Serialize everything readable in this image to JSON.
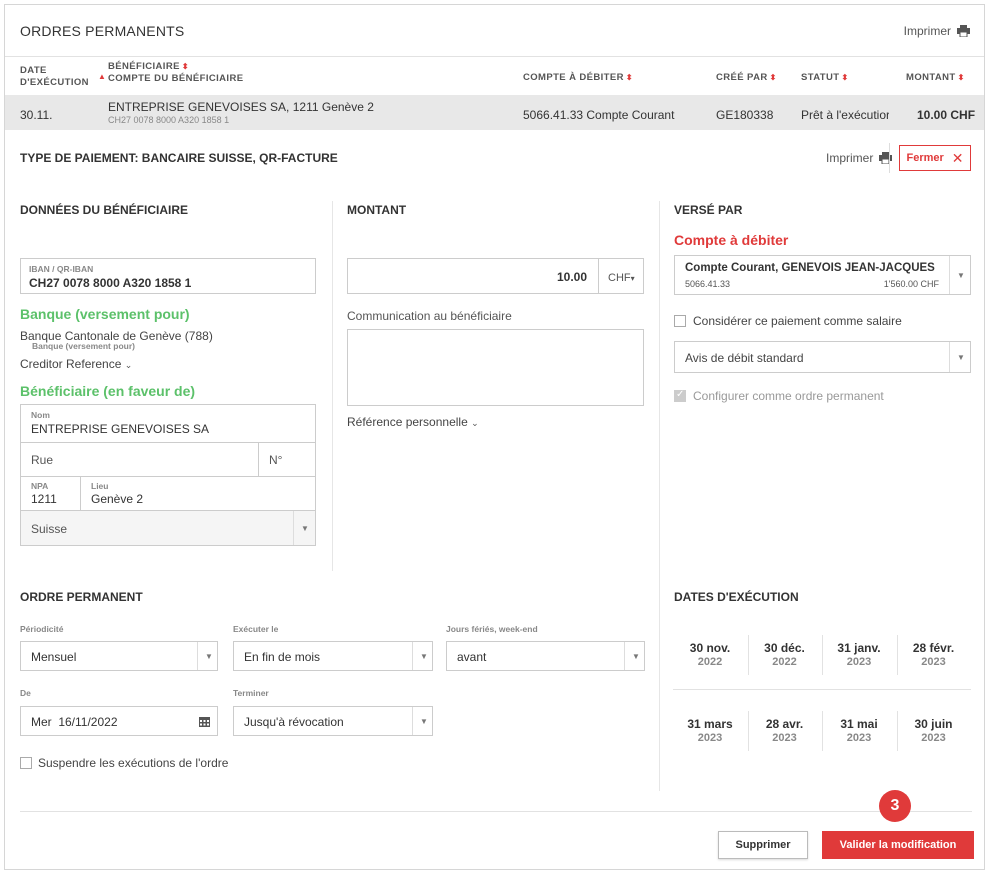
{
  "header": {
    "title": "ORDRES PERMANENTS",
    "print_label": "Imprimer"
  },
  "table": {
    "columns": {
      "date_line1": "DATE",
      "date_line2": "D'EXÉCUTION",
      "beneficiary_line1": "BÉNÉFICIAIRE",
      "beneficiary_line2": "COMPTE DU BÉNÉFICIAIRE",
      "debit_account": "COMPTE À DÉBITER",
      "created_by": "CRÉÉ PAR",
      "status": "STATUT",
      "amount": "MONTANT"
    },
    "row": {
      "date": "30.11.",
      "beneficiary": "ENTREPRISE GENEVOISES SA, 1211 Genève 2",
      "beneficiary_account": "CH27 0078 8000 A320 1858 1",
      "debit_account": "5066.41.33 Compte Courant",
      "created_by": "GE180338",
      "status": "Prêt à l'exécutior",
      "amount": "10.00 CHF"
    }
  },
  "detail": {
    "title": "TYPE DE PAIEMENT: BANCAIRE SUISSE, QR-FACTURE",
    "print_label": "Imprimer",
    "close_label": "Fermer"
  },
  "beneficiary": {
    "heading": "DONNÉES DU BÉNÉFICIAIRE",
    "iban_label": "IBAN / QR-IBAN",
    "iban_value": "CH27 0078 8000 A320 1858 1",
    "bank_heading": "Banque (versement pour)",
    "bank_name": "Banque Cantonale de Genève (788)",
    "bank_sub": "Banque (versement pour)",
    "creditor_ref": "Creditor Reference",
    "benef_heading": "Bénéficiaire (en faveur de)",
    "name_label": "Nom",
    "name_value": "ENTREPRISE GENEVOISES SA",
    "street_placeholder": "Rue",
    "number_placeholder": "N°",
    "npa_label": "NPA",
    "npa_value": "1211",
    "city_label": "Lieu",
    "city_value": "Genève 2",
    "country": "Suisse"
  },
  "amount": {
    "heading": "MONTANT",
    "value": "10.00",
    "currency": "CHF",
    "comm_label": "Communication au bénéficiaire",
    "personal_ref": "Référence personnelle"
  },
  "paid_by": {
    "heading": "VERSÉ PAR",
    "debit_heading": "Compte à débiter",
    "account_name": "Compte Courant, GENEVOIS JEAN-JACQUES",
    "account_number": "5066.41.33",
    "account_balance": "1'560.00 CHF",
    "salary_label": "Considérer ce paiement comme salaire",
    "debit_notice": "Avis de débit standard",
    "standing_order_label": "Configurer comme ordre permanent"
  },
  "standing_order": {
    "heading": "ORDRE PERMANENT",
    "periodicity_label": "Périodicité",
    "periodicity_value": "Mensuel",
    "execute_label": "Exécuter le",
    "execute_value": "En fin de mois",
    "holidays_label": "Jours fériés, week-end",
    "holidays_value": "avant",
    "from_label": "De",
    "from_value": "Mer  16/11/2022",
    "end_label": "Terminer",
    "end_value": "Jusqu'à révocation",
    "suspend_label": "Suspendre les exécutions de l'ordre"
  },
  "execution_dates": {
    "heading": "DATES D'EXÉCUTION",
    "dates": [
      {
        "day": "30 nov.",
        "year": "2022"
      },
      {
        "day": "30 déc.",
        "year": "2022"
      },
      {
        "day": "31 janv.",
        "year": "2023"
      },
      {
        "day": "28 févr.",
        "year": "2023"
      },
      {
        "day": "31 mars",
        "year": "2023"
      },
      {
        "day": "28 avr.",
        "year": "2023"
      },
      {
        "day": "31 mai",
        "year": "2023"
      },
      {
        "day": "30 juin",
        "year": "2023"
      }
    ]
  },
  "footer": {
    "delete_label": "Supprimer",
    "confirm_label": "Valider la modification",
    "step_badge": "3"
  },
  "colors": {
    "accent_red": "#e03a3a",
    "accent_green": "#5cc16a",
    "selected_row": "#e8e8e8"
  }
}
